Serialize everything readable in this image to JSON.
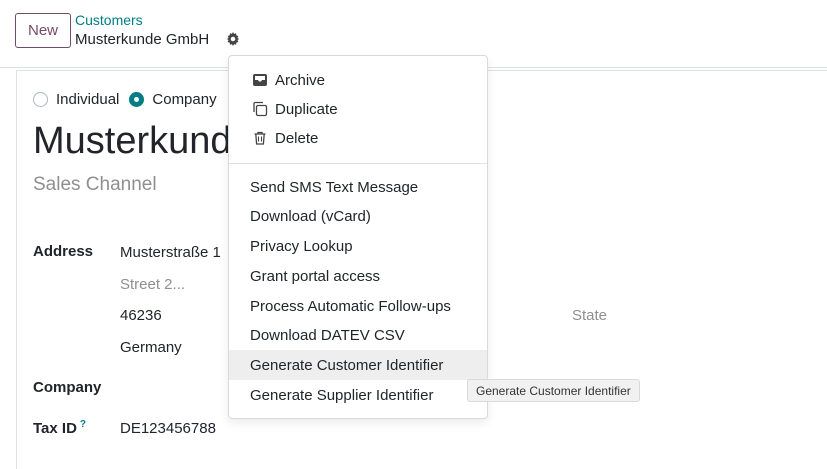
{
  "control_panel": {
    "new_label": "New",
    "breadcrumb": "Customers",
    "record_name": "Musterkunde GmbH"
  },
  "form": {
    "type_options": [
      "Individual",
      "Company"
    ],
    "selected_type": "Company",
    "title": "Musterkunde GmbH",
    "sales_channel_placeholder": "Sales Channel",
    "address_label": "Address",
    "street": "Musterstraße 1",
    "street2_placeholder": "Street 2...",
    "zip": "46236",
    "state_placeholder": "State",
    "country": "Germany",
    "company_label": "Company",
    "tax_id_label": "Tax ID",
    "tax_id_help": "?",
    "tax_id_value": "DE123456788"
  },
  "dropdown": {
    "group1": [
      {
        "label": "Archive",
        "icon": "archive-icon"
      },
      {
        "label": "Duplicate",
        "icon": "copy-icon"
      },
      {
        "label": "Delete",
        "icon": "trash-icon"
      }
    ],
    "group2": [
      "Send SMS Text Message",
      "Download (vCard)",
      "Privacy Lookup",
      "Grant portal access",
      "Process Automatic Follow-ups",
      "Download DATEV CSV",
      "Generate Customer Identifier",
      "Generate Supplier Identifier"
    ],
    "hovered": "Generate Customer Identifier"
  },
  "tooltip": "Generate Customer Identifier",
  "colors": {
    "brand": "#714b67",
    "accent": "#017e84"
  }
}
